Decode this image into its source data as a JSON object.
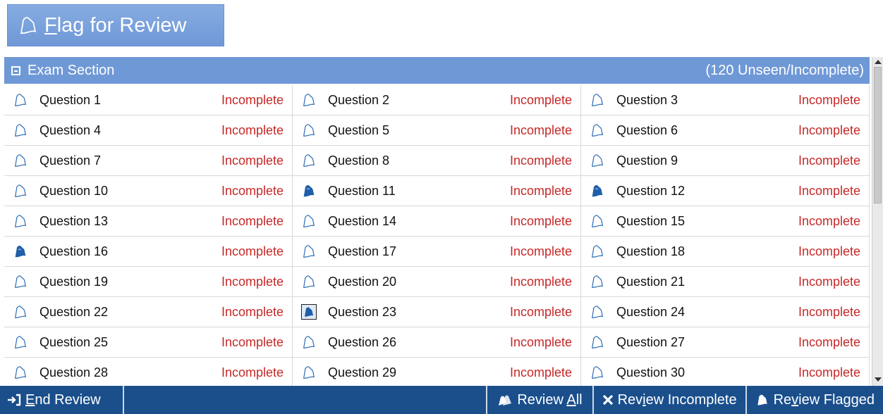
{
  "flag_button": {
    "pre": "",
    "mnemonic": "F",
    "post": "lag for Review",
    "icon": "flag-outline-icon"
  },
  "section": {
    "title": "Exam Section",
    "status": "(120 Unseen/Incomplete)"
  },
  "questions": [
    {
      "label": "Question 1",
      "status": "Incomplete",
      "icon": "flag-outline-icon"
    },
    {
      "label": "Question 2",
      "status": "Incomplete",
      "icon": "flag-outline-icon"
    },
    {
      "label": "Question 3",
      "status": "Incomplete",
      "icon": "flag-outline-icon"
    },
    {
      "label": "Question 4",
      "status": "Incomplete",
      "icon": "flag-outline-icon"
    },
    {
      "label": "Question 5",
      "status": "Incomplete",
      "icon": "flag-outline-icon"
    },
    {
      "label": "Question 6",
      "status": "Incomplete",
      "icon": "flag-outline-icon"
    },
    {
      "label": "Question 7",
      "status": "Incomplete",
      "icon": "flag-outline-icon"
    },
    {
      "label": "Question 8",
      "status": "Incomplete",
      "icon": "flag-outline-icon"
    },
    {
      "label": "Question 9",
      "status": "Incomplete",
      "icon": "flag-outline-icon"
    },
    {
      "label": "Question 10",
      "status": "Incomplete",
      "icon": "flag-outline-icon"
    },
    {
      "label": "Question 11",
      "status": "Incomplete",
      "icon": "flag-filled-icon"
    },
    {
      "label": "Question 12",
      "status": "Incomplete",
      "icon": "flag-filled-icon"
    },
    {
      "label": "Question 13",
      "status": "Incomplete",
      "icon": "flag-outline-icon"
    },
    {
      "label": "Question 14",
      "status": "Incomplete",
      "icon": "flag-outline-icon"
    },
    {
      "label": "Question 15",
      "status": "Incomplete",
      "icon": "flag-outline-icon"
    },
    {
      "label": "Question 16",
      "status": "Incomplete",
      "icon": "flag-filled-icon"
    },
    {
      "label": "Question 17",
      "status": "Incomplete",
      "icon": "flag-outline-icon"
    },
    {
      "label": "Question 18",
      "status": "Incomplete",
      "icon": "flag-outline-icon"
    },
    {
      "label": "Question 19",
      "status": "Incomplete",
      "icon": "flag-outline-icon"
    },
    {
      "label": "Question 20",
      "status": "Incomplete",
      "icon": "flag-outline-icon"
    },
    {
      "label": "Question 21",
      "status": "Incomplete",
      "icon": "flag-outline-icon"
    },
    {
      "label": "Question 22",
      "status": "Incomplete",
      "icon": "flag-outline-icon"
    },
    {
      "label": "Question 23",
      "status": "Incomplete",
      "icon": "flag-filled-boxed-icon"
    },
    {
      "label": "Question 24",
      "status": "Incomplete",
      "icon": "flag-outline-icon"
    },
    {
      "label": "Question 25",
      "status": "Incomplete",
      "icon": "flag-outline-icon"
    },
    {
      "label": "Question 26",
      "status": "Incomplete",
      "icon": "flag-outline-icon"
    },
    {
      "label": "Question 27",
      "status": "Incomplete",
      "icon": "flag-outline-icon"
    },
    {
      "label": "Question 28",
      "status": "Incomplete",
      "icon": "flag-outline-icon"
    },
    {
      "label": "Question 29",
      "status": "Incomplete",
      "icon": "flag-outline-icon"
    },
    {
      "label": "Question 30",
      "status": "Incomplete",
      "icon": "flag-outline-icon"
    }
  ],
  "bottom_bar": {
    "end_review": {
      "pre": "",
      "mnemonic": "E",
      "post": "nd Review",
      "icon": "exit-arrow-icon"
    },
    "review_all": {
      "pre": "Review ",
      "mnemonic": "A",
      "post": "ll",
      "icon": "review-all-icon"
    },
    "review_incomplete": {
      "pre": "Rev",
      "mnemonic": "i",
      "post": "ew Incomplete",
      "icon": "x-icon"
    },
    "review_flagged": {
      "pre": "Re",
      "mnemonic": "v",
      "post": "iew Flagged",
      "icon": "flag-filled-icon"
    }
  },
  "colors": {
    "header_bg": "#6f98d6",
    "bottom_bar_bg": "#1a4f8c",
    "status_red": "#c62828",
    "flag_blue": "#1f5fa8"
  }
}
